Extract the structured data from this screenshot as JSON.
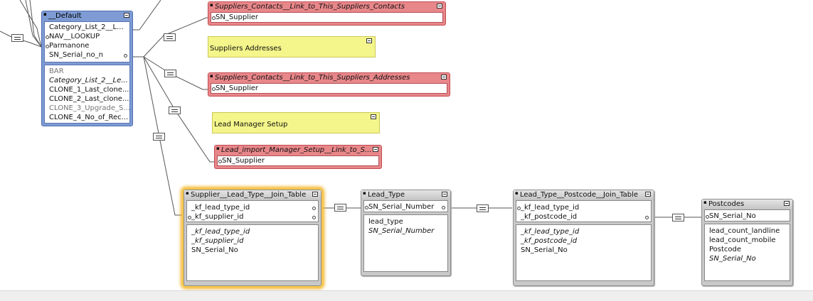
{
  "tables": {
    "default": {
      "title": "__Default",
      "fields_top": [
        "Category_List_2__L...",
        "NAV__LOOKUP",
        "Parmanone",
        "SN_Serial_no_n"
      ],
      "fields_bottom": [
        {
          "name": "BAR",
          "style": "gray"
        },
        {
          "name": "Category_List_2__Le...",
          "style": "italic"
        },
        {
          "name": "CLONE_1_Last_clone...",
          "style": "normal"
        },
        {
          "name": "CLONE_2_Last_clone...",
          "style": "normal"
        },
        {
          "name": "CLONE_3_Upgrade_S...",
          "style": "gray"
        },
        {
          "name": "CLONE_4_No_of_Rec...",
          "style": "normal"
        }
      ]
    },
    "contacts": {
      "title": "Suppliers_Contacts__Link_to_This_Suppliers_Contacts",
      "field": "SN_Supplier"
    },
    "addresses": {
      "title": "Suppliers_Contacts__Link_to_This_Suppliers_Addresses",
      "field": "SN_Supplier"
    },
    "lead_import": {
      "title": "Lead_import_Manager_Setup__Link_to_S...",
      "field": "SN_Supplier"
    },
    "supplier_join": {
      "title": "Supplier__Lead_Type__Join_Table",
      "fields_top": [
        "_kf_lead_type_id",
        "_kf_supplier_id"
      ],
      "fields_bottom": [
        {
          "name": "_kf_lead_type_id",
          "style": "italic"
        },
        {
          "name": "_kf_supplier_id",
          "style": "italic"
        },
        {
          "name": "SN_Serial_No",
          "style": "normal"
        }
      ]
    },
    "lead_type": {
      "title": "Lead_Type",
      "fields_top": [
        "SN_Serial_Number"
      ],
      "fields_bottom": [
        {
          "name": "lead_type",
          "style": "normal"
        },
        {
          "name": "SN_Serial_Number",
          "style": "italic"
        }
      ]
    },
    "postcode_join": {
      "title": "Lead_Type__Postcode__Join_Table",
      "fields_top": [
        "_kf_lead_type_id",
        "_kf_postcode_id"
      ],
      "fields_bottom": [
        {
          "name": "_kf_lead_type_id",
          "style": "italic"
        },
        {
          "name": "_kf_postcode_id",
          "style": "italic"
        },
        {
          "name": "SN_Serial_No",
          "style": "normal"
        }
      ]
    },
    "postcodes": {
      "title": "Postcodes",
      "fields_top": [
        "SN_Serial_No"
      ],
      "fields_bottom": [
        {
          "name": "lead_count_landline",
          "style": "normal"
        },
        {
          "name": "lead_count_mobile",
          "style": "normal"
        },
        {
          "name": "Postcode",
          "style": "normal"
        },
        {
          "name": "SN_Serial_No",
          "style": "italic"
        }
      ]
    }
  },
  "notes": {
    "suppliers_addresses": "Suppliers Addresses",
    "lead_manager_setup": "Lead Manager Setup"
  },
  "colors": {
    "table_gray": "#c9c9c9",
    "table_blue": "#7e9bd4",
    "table_red": "#e8878a",
    "note_yellow": "#f4f58a",
    "selection_glow": "#f2b327"
  }
}
